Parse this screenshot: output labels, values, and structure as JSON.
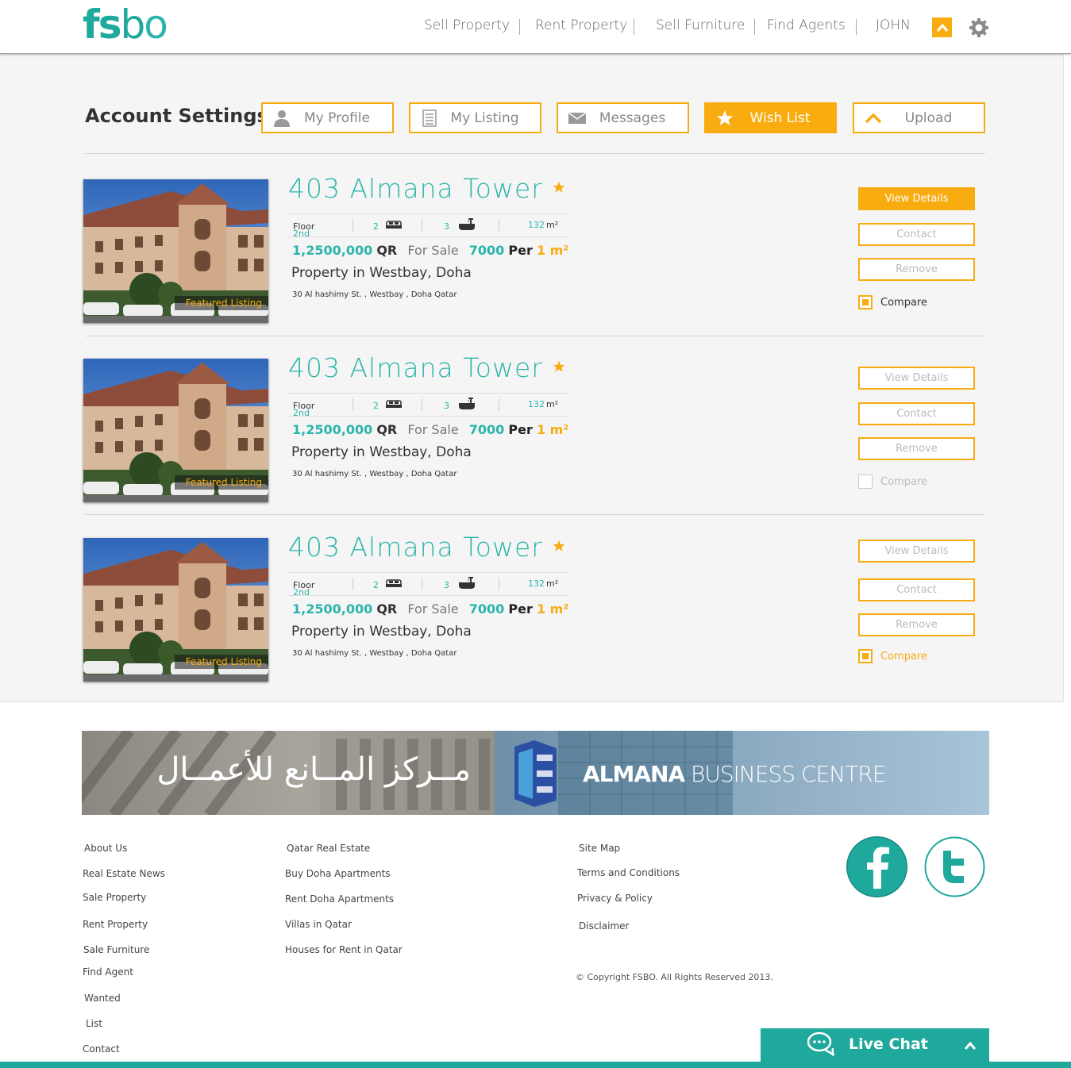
{
  "brand": {
    "logo_f": "f",
    "logo_s": "s",
    "logo_b": "b",
    "logo_o": "o",
    "accent": "#f8ac10",
    "teal": "#1fa89c"
  },
  "nav": {
    "items": [
      "Sell Property",
      "Rent Property",
      "Sell Furniture",
      "Find Agents"
    ],
    "user": "JOHN"
  },
  "account": {
    "title": "Account Settings",
    "tabs": [
      {
        "label": "My Profile",
        "icon": "user-icon",
        "active": false
      },
      {
        "label": "My Listing",
        "icon": "list-icon",
        "active": false
      },
      {
        "label": "Messages",
        "icon": "envelope-icon",
        "active": false
      },
      {
        "label": "Wish List",
        "icon": "star-icon",
        "active": true
      },
      {
        "label": "Upload",
        "icon": "upload-chevron-icon",
        "active": false
      }
    ]
  },
  "listings": [
    {
      "title": "403  Almana  Tower",
      "floor_num": "2nd",
      "floor_label": "Floor",
      "beds": "2",
      "baths": "3",
      "area": "132",
      "area_unit": "m²",
      "price": "1,2500,000",
      "currency": "QR",
      "status": "For Sale",
      "per_meter": "7000",
      "per_label": "Per",
      "per_unit": "1 m²",
      "type": "Property in Westbay, Doha",
      "address": "30 Al hashimy St. , Westbay , Doha Qatar",
      "badge": "Featured Listing",
      "actions": {
        "view": "View Details",
        "contact": "Contact",
        "remove": "Remove",
        "compare": "Compare"
      },
      "view_primary": true,
      "compare_checked": true,
      "compare_color": "#333333"
    },
    {
      "title": "403  Almana  Tower",
      "floor_num": "2nd",
      "floor_label": "Floor",
      "beds": "2",
      "baths": "3",
      "area": "132",
      "area_unit": "m²",
      "price": "1,2500,000",
      "currency": "QR",
      "status": "For Sale",
      "per_meter": "7000",
      "per_label": "Per",
      "per_unit": "1 m²",
      "type": "Property in Westbay, Doha",
      "address": "30 Al hashimy St. , Westbay , Doha Qatar",
      "badge": "Featured Listing",
      "actions": {
        "view": "View Details",
        "contact": "Contact",
        "remove": "Remove",
        "compare": "Compare"
      },
      "view_primary": false,
      "compare_checked": false,
      "compare_color": "#bbbbbb"
    },
    {
      "title": "403  Almana  Tower",
      "floor_num": "2nd",
      "floor_label": "Floor",
      "beds": "2",
      "baths": "3",
      "area": "132",
      "area_unit": "m²",
      "price": "1,2500,000",
      "currency": "QR",
      "status": "For Sale",
      "per_meter": "7000",
      "per_label": "Per",
      "per_unit": "1 m²",
      "type": "Property in Westbay, Doha",
      "address": "30 Al hashimy St. , Westbay , Doha Qatar",
      "badge": "Featured Listing",
      "actions": {
        "view": "View Details",
        "contact": "Contact",
        "remove": "Remove",
        "compare": "Compare"
      },
      "view_primary": false,
      "compare_checked": true,
      "compare_color": "#f8ac10"
    }
  ],
  "banner": {
    "arabic": "مــركز المــانع للأعمــال",
    "brand_bold": "ALMANA",
    "brand_rest": " BUSINESS CENTRE"
  },
  "footer": {
    "col1": [
      "About Us",
      "Real Estate News",
      "Sale Property",
      "Rent Property",
      "Sale Furniture",
      "Find Agent",
      "Wanted",
      "List",
      "Contact"
    ],
    "col2": [
      "Qatar Real Estate",
      "Buy Doha Apartments",
      "Rent Doha Apartments",
      "Villas in Qatar",
      "Houses for Rent in Qatar"
    ],
    "col3": [
      "Site Map",
      "Terms and Conditions",
      "Privacy & Policy",
      "Disclaimer"
    ],
    "copyright": "© Copyright FSBO. All Rights Reserved 2013."
  },
  "livechat": {
    "label": "Live Chat"
  }
}
